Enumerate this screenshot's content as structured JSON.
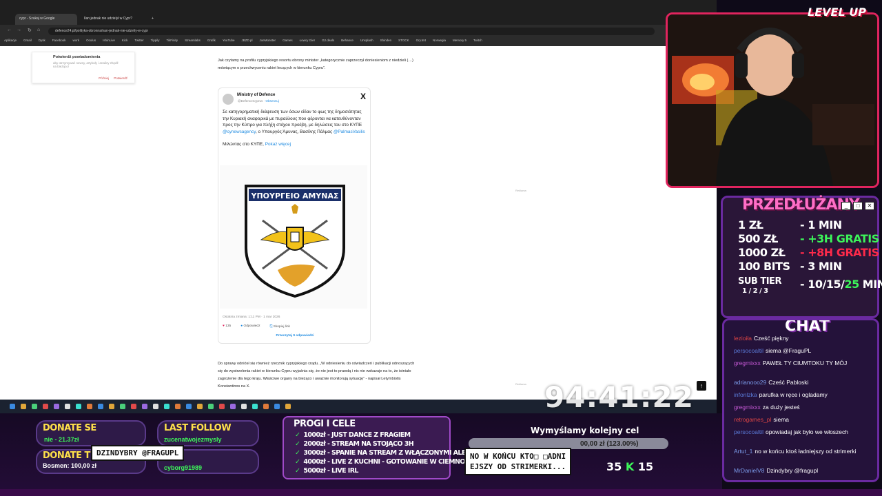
{
  "browser": {
    "tabs": [
      "cypr - Szukaj w Google",
      "Ilan jednak nie udzielył w Cypr?"
    ],
    "url": "defence24.pl/polityka-obronna/nan-jednak-nie-udzeliy-w-cypr",
    "bookmarks": [
      "Aplikacje",
      "Gmail",
      "Dysk",
      "Facebook",
      "work",
      "Oculus",
      "IshinLive",
      "Kick",
      "Twitter",
      "Tippily",
      "TikFinity",
      "Streamlabs",
      "Grafik",
      "YouTube",
      "JBZD.pl",
      "JoeMonster",
      "Games",
      "Łowcy Gier",
      "G2.deals",
      "Behance",
      "Unsplash",
      "Shinden",
      "STOCK",
      "Gry.tmt",
      "Norwegia",
      "Memory 5",
      "Twitch"
    ]
  },
  "page": {
    "notification": {
      "title": "Potwierdź powiadomienia",
      "text": "aby otrzymywać newsy, artykuły i analizy zbędź na bieżąco!",
      "later": "Później",
      "confirm": "Potwierdź"
    },
    "para1": "Jak czytamy na profilu cypryjskiego resortu obrony minister „kategorycznie zaprzeczył doniesieniom z niedzieli (…) mówiącym o przechwyceniu rakiet lecących w kierunku Cypru”.",
    "tweet": {
      "author": "Ministry of Defence",
      "handle": "@DefenceCyprus",
      "follow": "Obserwuj",
      "text_a": "Σε κατηγορηματική διάψευση των όσων είδαν το φως της δημοσιότητας την Κυριακή αναφορικά με πυραύλους που φέρονται να κατευθύνονταν προς την Κύπρο για πλήξη στόχου προέβη, με δηλώσεις του στο ΚΥΠΕ ",
      "mention1": "@cynewsagency",
      "text_b": ", ο Υπουργός Άμυνας, Βασίλης Πάλμας ",
      "mention2": "@PalmasVasilis",
      "source": "Μιλώντας στο ΚΥΠΕ,",
      "show_more": "Pokaż więcej",
      "emblem_text": "ΥΠΟΥΡΓΕΙΟ ΑΜΥΝΑΣ",
      "timestamp": "Ostatnia zmiana: 1:11 PM · 1 mar 2026",
      "likes": "135",
      "reply": "Odpowiedz",
      "copy": "Skopiuj link",
      "read_replies": "Przeczytaj 9 odpowiedzi"
    },
    "ad_label": "Reklama",
    "para2": "Do sprawy odniósł się również rzecznik cypryjskiego rządu. „W odniesieniu do oświadczeń i publikacji odnoszących się do wystrzelenia rakiet w kierunku Cypru wyjaśnia się, że nie jest to prawdą i nic nie wskazuje na to, że istniało zagrożenie dla tego kraju. Właściwe organy na bieżąco i uważnie monitorują sytuację” - napisał Letymbiotis Konstantinos na X."
  },
  "overlay": {
    "timer": "94:41:22",
    "logo": "LEVEL UP"
  },
  "subathon": {
    "title": "PRZEDŁUŻANY",
    "rows": [
      {
        "left": "1 ZŁ",
        "right": "- 1 MIN"
      },
      {
        "left": "500 ZŁ",
        "right": "- +3H GRATIS"
      },
      {
        "left": "1000 ZŁ",
        "right": "- +8H GRATIS"
      },
      {
        "left": "100 BITS",
        "right": "- 3 MIN"
      }
    ],
    "tier_label": "SUB TIER",
    "tier_levels": "1 / 2 / 3",
    "tier_values_a": "- 10/15/",
    "tier_values_b": "25",
    "tier_values_c": " MIN"
  },
  "chat": {
    "title": "CHAT",
    "messages": [
      {
        "user": "lezioiła",
        "text": "Cześć piękny"
      },
      {
        "user": "persocoaltil",
        "text": "siema @FraguPL"
      },
      {
        "user": "gregmixxx",
        "text": "PAWEŁ TY CIUMTOKU TY MÓJ"
      },
      {
        "user": "adrianooo29",
        "text": "Cześć Pabloski"
      },
      {
        "user": "infonlzka",
        "text": "parufka w ręce i ogladamy"
      },
      {
        "user": "gregmixxx",
        "text": "za duży jesteś"
      },
      {
        "user": "retrogames_pl",
        "text": "siema"
      },
      {
        "user": "persocoaltil",
        "text": "opowiadaj jak było we włoszech"
      },
      {
        "user": "Artut_1",
        "text": "no w końcu ktoś ładniejszy od strimerki"
      },
      {
        "user": "MrDanielV8",
        "text": "Dzindybry @fragupl"
      }
    ]
  },
  "bottom": {
    "donate_se_title": "DONATE SE",
    "donate_se_value": "nie - 21.37zł",
    "donate_tp_title": "DONATE TP",
    "donate_tp_value": "Bosmen: 100,00 zł",
    "last_follow_title": "LAST FOLLOW",
    "last_follow_value": "zucenatwojezmysly",
    "last_sub_value": "cyborg91989",
    "alert_callout": "DZINDYBRY @FRAGUPL"
  },
  "progi": {
    "title": "PROGI I CELE",
    "items": [
      "1000zł - JUST DANCE Z FRAGIEM",
      "2000zł - STREAM NA STOJĄCO 3H",
      "3000zł - SPANIE NA STREAM Z WŁĄCZONYMI ALERTAMI",
      "4000zł - LIVE Z KUCHNI - GOTOWANIE W CIEMNO",
      "5000zł - LIVE IRL"
    ]
  },
  "goal": {
    "title": "Wymyślamy kolejny cel",
    "progress_text": "00,00 zł (123.00%)",
    "progress_fraction": 1.0,
    "alert_line1": "NO W KOŃCU KTO□ □ADNI",
    "alert_line2": "EJSZY OD STRIMERKI...",
    "counter_a": "35",
    "counter_b": "15"
  }
}
